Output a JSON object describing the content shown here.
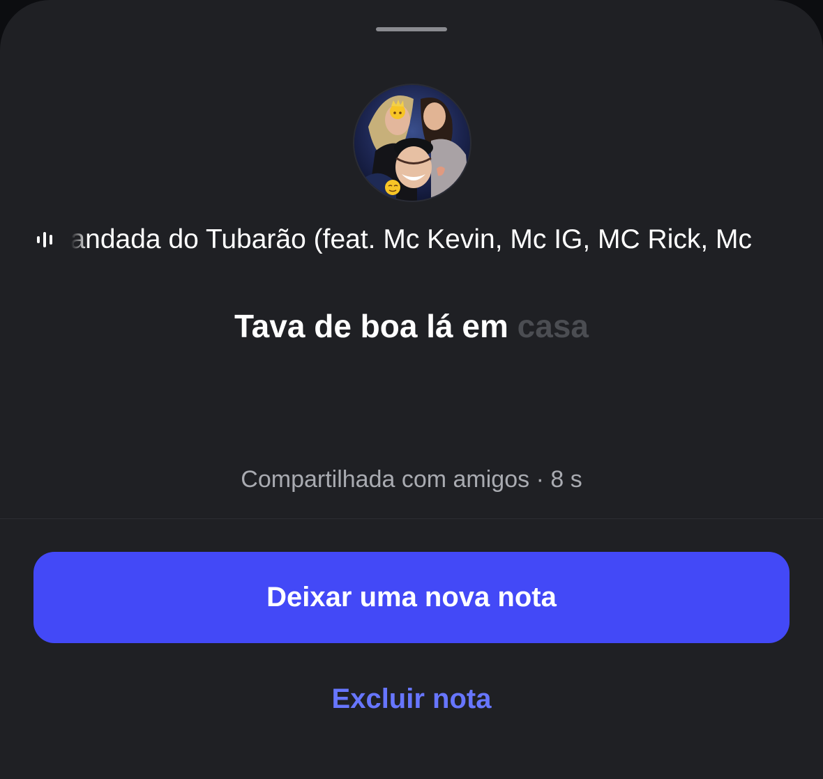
{
  "note_sheet": {
    "music": {
      "icon": "audio-waveform-icon",
      "track_text": "Mandada do Tubarão (feat. Mc Kevin, Mc IG, MC Rick, Mc"
    },
    "note": {
      "text_visible": "Tava de boa lá em",
      "text_faded": "casa"
    },
    "shared_info": "Compartilhada com amigos · 8 s",
    "primary_button_label": "Deixar uma nova nota",
    "delete_button_label": "Excluir nota"
  },
  "colors": {
    "sheet_background": "#1f2024",
    "primary_button": "#4349f7",
    "link": "#6776ff",
    "secondary_text": "#a9abb1",
    "faded_text": "#4b4d52"
  }
}
